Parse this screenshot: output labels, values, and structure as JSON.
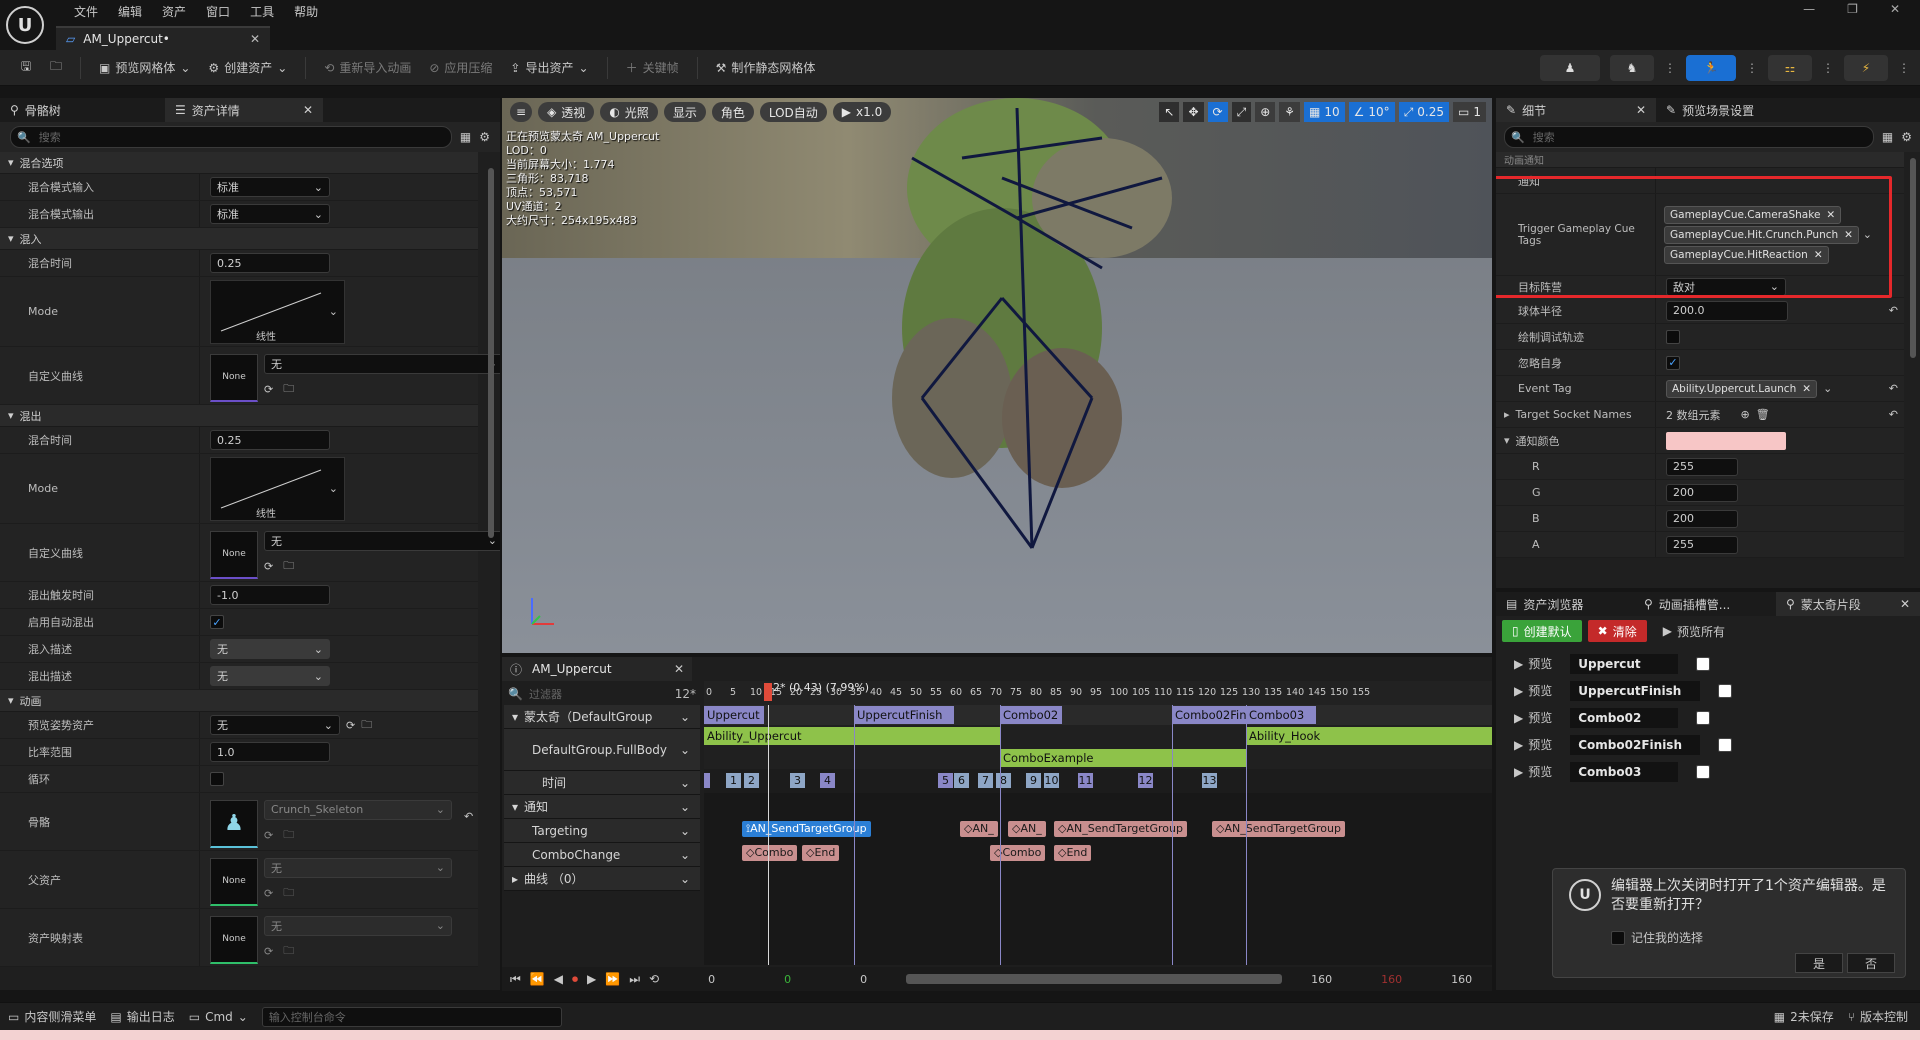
{
  "menu": [
    "文件",
    "编辑",
    "资产",
    "窗口",
    "工具",
    "帮助"
  ],
  "doc_tab": {
    "label": "AM_Uppercut•"
  },
  "toolbar": {
    "preview_mesh": "预览网格体",
    "create_asset": "创建资产",
    "reimport": "重新导入动画",
    "apply_compression": "应用压缩",
    "export_asset": "导出资产",
    "keyframe": "关键帧",
    "make_static_mesh": "制作静态网格体"
  },
  "left_panel": {
    "tab_skeleton": "骨骼树",
    "tab_asset": "资产详情",
    "search_placeholder": "搜索",
    "sections": {
      "blend_options": "混合选项",
      "blend_in": "混入",
      "blend_out": "混出",
      "animation": "动画"
    },
    "rows": {
      "blend_mode_in": {
        "label": "混合模式输入",
        "value": "标准"
      },
      "blend_mode_out": {
        "label": "混合模式输出",
        "value": "标准"
      },
      "in_time": {
        "label": "混合时间",
        "value": "0.25"
      },
      "in_mode": {
        "label": "Mode",
        "value": "线性"
      },
      "in_curve": {
        "label": "自定义曲线",
        "value": "无",
        "thumb": "None"
      },
      "out_time": {
        "label": "混合时间",
        "value": "0.25"
      },
      "out_mode": {
        "label": "Mode",
        "value": "线性"
      },
      "out_curve": {
        "label": "自定义曲线",
        "value": "无",
        "thumb": "None"
      },
      "trigger_time": {
        "label": "混出触发时间",
        "value": "-1.0"
      },
      "auto_blend": {
        "label": "启用自动混出"
      },
      "blend_in_desc": {
        "label": "混入描述",
        "value": "无"
      },
      "blend_out_desc": {
        "label": "混出描述",
        "value": "无"
      },
      "preview_pose": {
        "label": "预览姿势资产",
        "value": "无"
      },
      "rate_scale": {
        "label": "比率范围",
        "value": "1.0"
      },
      "loop": {
        "label": "循环"
      },
      "skeleton": {
        "label": "骨骼",
        "value": "Crunch_Skeleton"
      },
      "parent_asset": {
        "label": "父资产",
        "value": "无",
        "thumb": "None"
      },
      "asset_mapping": {
        "label": "资产映射表",
        "value": "无",
        "thumb": "None"
      }
    }
  },
  "viewport": {
    "buttons": {
      "menu": "≡",
      "perspective": "透视",
      "lit": "光照",
      "show": "显示",
      "character": "角色",
      "lod": "LOD自动",
      "speed": "x1.0"
    },
    "grid": "10",
    "angle": "10°",
    "scale": "0.25",
    "camera": "1",
    "info": [
      "正在预览蒙太奇 AM_Uppercut",
      "LOD：0",
      "当前屏幕大小：1.774",
      "三角形：83,718",
      "顶点：53,571",
      "UV通道：2",
      "大约尺寸：254x195x483"
    ]
  },
  "timeline": {
    "tab": "AM_Uppercut",
    "filter_placeholder": "过滤器",
    "frame_count": "12*",
    "playhead": "12* (0.43) (7.99%)",
    "ticks": [
      "0",
      "5",
      "10",
      "15",
      "20",
      "25",
      "30",
      "35",
      "40",
      "45",
      "50",
      "55",
      "60",
      "65",
      "70",
      "75",
      "80",
      "85",
      "90",
      "95",
      "100",
      "105",
      "110",
      "115",
      "120",
      "125",
      "130",
      "135",
      "140",
      "145",
      "150",
      "155"
    ],
    "tracks": {
      "montage": "蒙太奇（DefaultGroup",
      "slot": "DefaultGroup.FullBody",
      "time": "时间",
      "notifies": "通知",
      "targeting": "Targeting",
      "combo_change": "ComboChange",
      "curves": "曲线 （0）"
    },
    "sections": [
      "Uppercut",
      "UppercutFinish",
      "Combo02",
      "Combo02Fin",
      "Combo03"
    ],
    "segments": [
      "Ability_Uppercut",
      "ComboExample",
      "Ability_Hook"
    ],
    "markers": [
      "1",
      "2",
      "3",
      "4",
      "5",
      "6",
      "7",
      "8",
      "9",
      "10",
      "11",
      "12",
      "13"
    ],
    "notifies_targeting": [
      "AN_SendTargetGroup",
      "AN_",
      "AN_",
      "AN_SendTargetGroup",
      "AN_SendTargetGroup"
    ],
    "notifies_combo": [
      "Combo",
      "End",
      "Combo",
      "End"
    ],
    "transport": {
      "start": "0",
      "green": "0",
      "cur": "0",
      "end1": "160",
      "red": "160",
      "end2": "160"
    }
  },
  "details": {
    "tab_details": "细节",
    "tab_preview": "预览场景设置",
    "search_placeholder": "搜索",
    "category": "动画通知",
    "notify_label": "通知",
    "trigger_label": "Trigger Gameplay Cue Tags",
    "tags": [
      "GameplayCue.CameraShake",
      "GameplayCue.Hit.Crunch.Punch",
      "GameplayCue.HitReaction"
    ],
    "target_team": {
      "label": "目标阵营",
      "value": "敌对"
    },
    "sphere_radius": {
      "label": "球体半径",
      "value": "200.0"
    },
    "draw_debug": {
      "label": "绘制调试轨迹"
    },
    "ignore_self": {
      "label": "忽略自身"
    },
    "event_tag": {
      "label": "Event Tag",
      "value": "Ability.Uppercut.Launch"
    },
    "socket_names": {
      "label": "Target Socket Names",
      "value": "2 数组元素"
    },
    "notify_color": {
      "label": "通知颜色",
      "swatch": "#f7c6c6"
    },
    "r": {
      "label": "R",
      "value": "255"
    },
    "g": {
      "label": "G",
      "value": "200"
    },
    "b": {
      "label": "B",
      "value": "200"
    },
    "a": {
      "label": "A",
      "value": "255"
    },
    "highlight_color": "#e5282b"
  },
  "bottom_right": {
    "tab_browser": "资产浏览器",
    "tab_slots": "动画插槽管...",
    "tab_montage": "蒙太奇片段",
    "create_default": "创建默认",
    "clear": "清除",
    "preview_all": "预览所有",
    "preview_label": "预览",
    "sections": [
      "Uppercut",
      "UppercutFinish",
      "Combo02",
      "Combo02Finish",
      "Combo03"
    ]
  },
  "toast": {
    "text": "编辑器上次关闭时打开了1个资产编辑器。是否要重新打开？",
    "remember": "记住我的选择",
    "yes": "是",
    "no": "否"
  },
  "status_bar": {
    "content_drawer": "内容侧滑菜单",
    "output_log": "输出日志",
    "cmd": "Cmd",
    "console_placeholder": "输入控制台命令",
    "unsaved": "2未保存",
    "source_control": "版本控制"
  }
}
